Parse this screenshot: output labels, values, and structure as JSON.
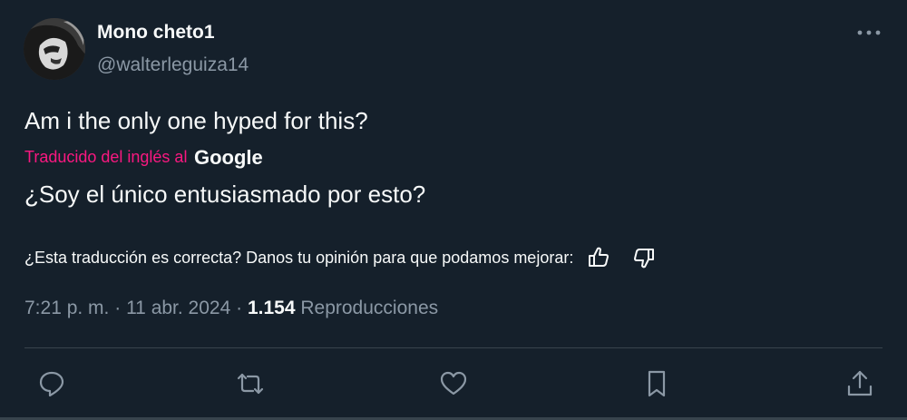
{
  "author": {
    "display_name": "Mono cheto1",
    "handle": "@walterleguiza14"
  },
  "tweet": {
    "text": "Am i the only one hyped for this?",
    "translated_label": "Traducido del inglés al",
    "translator_brand": "Google",
    "translation": "¿Soy el único entusiasmado por esto?"
  },
  "feedback": {
    "prompt": "¿Esta traducción es correcta? Danos tu opinión para que podamos mejorar:"
  },
  "meta": {
    "time": "7:21 p. m.",
    "separator": " · ",
    "date": "11 abr. 2024",
    "views_count": "1.154",
    "views_label": "Reproducciones"
  },
  "actions": [
    "reply",
    "retweet",
    "like",
    "bookmark",
    "share"
  ],
  "colors": {
    "background": "#15202b",
    "primary_text": "#f7f9f9",
    "secondary_text": "#8b98a5",
    "translated_label": "#f91880",
    "icon": "#8b98a5",
    "divider": "#38444d"
  }
}
